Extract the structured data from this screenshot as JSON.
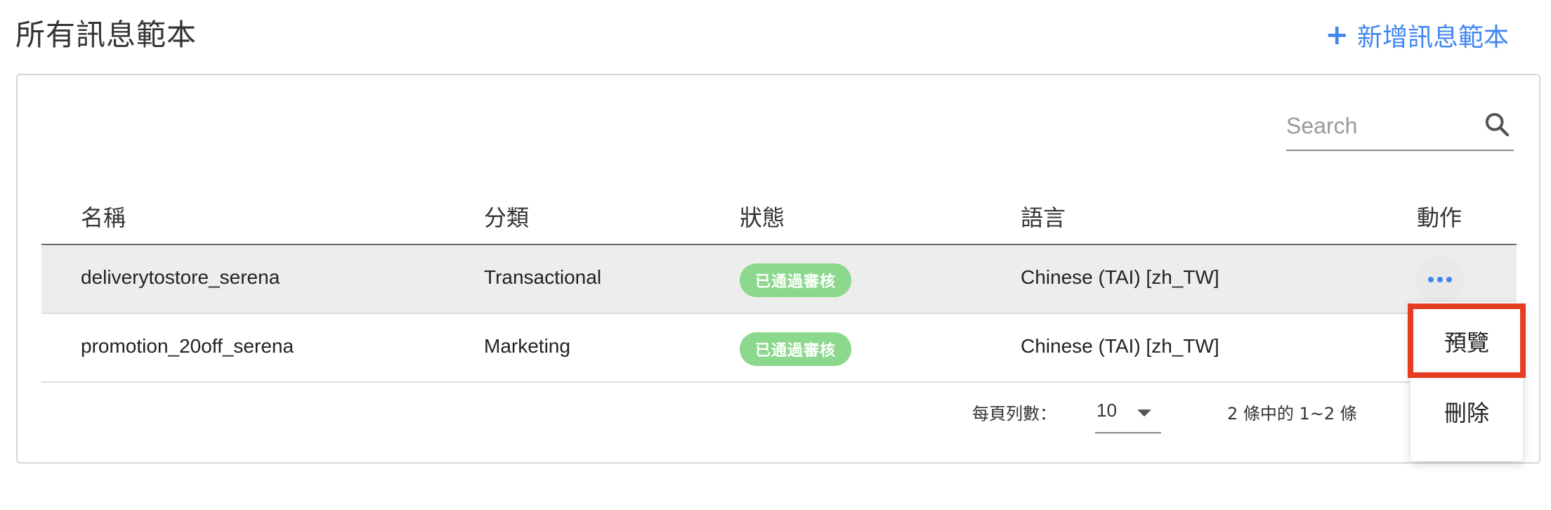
{
  "page": {
    "title": "所有訊息範本",
    "add_button_label": "新增訊息範本",
    "add_icon": "+"
  },
  "search": {
    "placeholder": "Search",
    "icon": "search-icon"
  },
  "table": {
    "columns": [
      "名稱",
      "分類",
      "狀態",
      "語言",
      "動作"
    ],
    "rows": [
      {
        "name": "deliverytostore_serena",
        "category": "Transactional",
        "status": "已通過審核",
        "language": "Chinese (TAI) [zh_TW]",
        "action_icon": "more-horizontal-icon"
      },
      {
        "name": "promotion_20off_serena",
        "category": "Marketing",
        "status": "已通過審核",
        "language": "Chinese (TAI) [zh_TW]",
        "action_icon": "more-horizontal-icon"
      }
    ]
  },
  "pagination": {
    "rows_per_page_label": "每頁列數：",
    "rows_per_page_value": "10",
    "range_text": "2 條中的 1~2 條",
    "prev_icon": "chevron-left-icon"
  },
  "action_menu": {
    "items": [
      "預覽",
      "刪除"
    ],
    "highlighted_item": "預覽"
  },
  "colors": {
    "accent": "#3f86f0",
    "status_approved": "#8cd98e",
    "highlight_border": "#e53c22",
    "selected_row_bg": "#ededed"
  }
}
